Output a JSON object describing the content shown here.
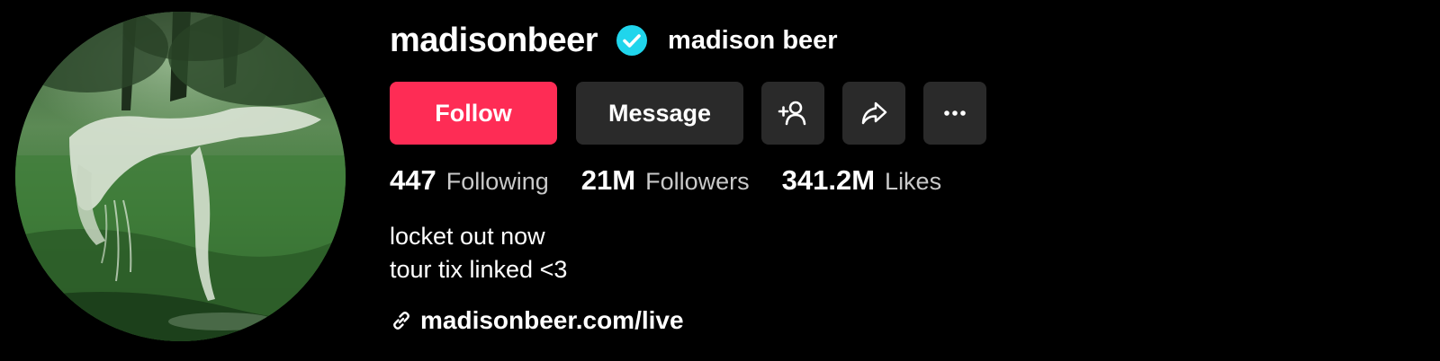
{
  "profile": {
    "username": "madisonbeer",
    "display_name": "madison beer",
    "verified": true,
    "verified_color": "#20d5ec"
  },
  "actions": {
    "follow_label": "Follow",
    "message_label": "Message",
    "add_friend_icon": "person-plus-icon",
    "share_icon": "share-arrow-icon",
    "more_icon": "more-dots-icon"
  },
  "stats": {
    "following_count": "447",
    "following_label": "Following",
    "followers_count": "21M",
    "followers_label": "Followers",
    "likes_count": "341.2M",
    "likes_label": "Likes"
  },
  "bio": {
    "line1": "locket out now",
    "line2": "tour tix linked <3"
  },
  "link": {
    "icon": "link-icon",
    "text": "madisonbeer.com/live"
  },
  "colors": {
    "background": "#000000",
    "follow_button": "#fe2c55",
    "secondary_button": "#2a2a2a",
    "muted_text": "#c9c9c9"
  }
}
